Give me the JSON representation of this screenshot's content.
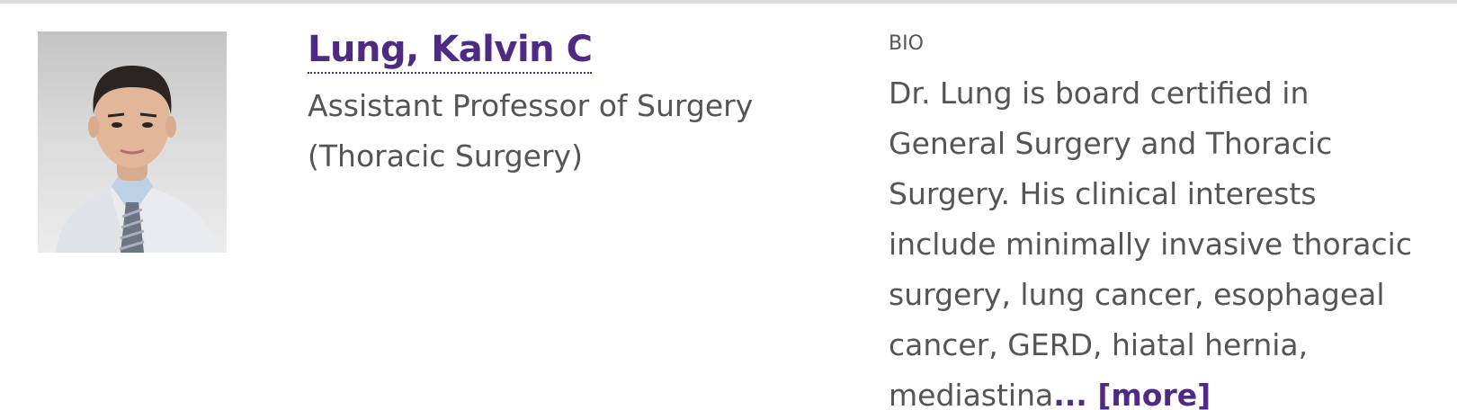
{
  "profile": {
    "name": "Lung, Kalvin C",
    "title_line1": "Assistant Professor of Surgery",
    "title_line2": "(Thoracic Surgery)"
  },
  "bio": {
    "label": "BIO",
    "text": "Dr. Lung is board certified in General Surgery and Thoracic Surgery. His clinical interests include minimally invasive thoracic surgery, lung cancer, esophageal cancer, GERD, hiatal hernia, mediastina",
    "more_label": "... [more]"
  },
  "colors": {
    "link": "#4e2a84",
    "text": "#555555",
    "rule": "#dcdcdc"
  }
}
